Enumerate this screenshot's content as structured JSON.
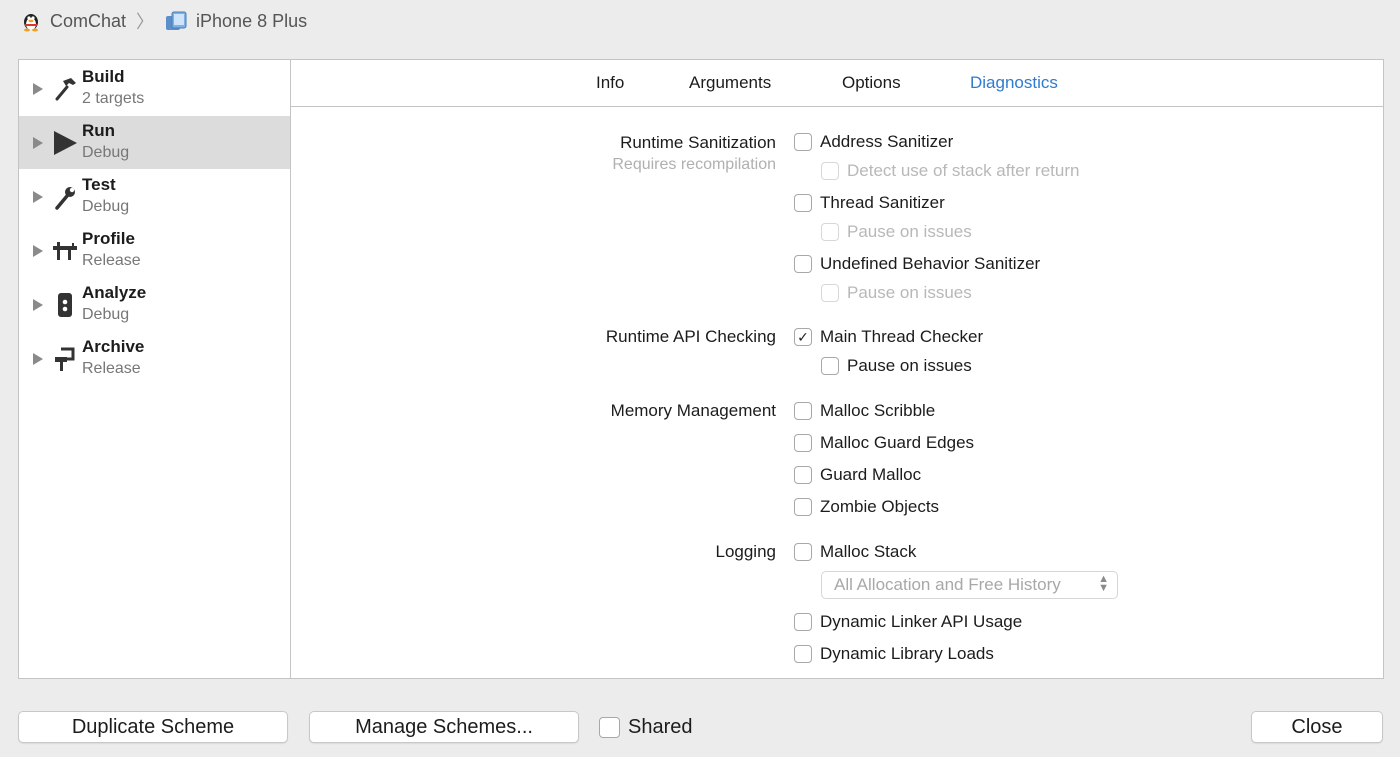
{
  "breadcrumb": {
    "scheme": "ComChat",
    "separator": "〉",
    "destination": "iPhone 8 Plus"
  },
  "sidebar": {
    "actions": [
      {
        "name": "Build",
        "sub": "2 targets",
        "icon": "hammer-icon",
        "selected": false
      },
      {
        "name": "Run",
        "sub": "Debug",
        "icon": "play-icon",
        "selected": true
      },
      {
        "name": "Test",
        "sub": "Debug",
        "icon": "wrench-icon",
        "selected": false
      },
      {
        "name": "Profile",
        "sub": "Release",
        "icon": "caliper-icon",
        "selected": false
      },
      {
        "name": "Analyze",
        "sub": "Debug",
        "icon": "analyze-icon",
        "selected": false
      },
      {
        "name": "Archive",
        "sub": "Release",
        "icon": "archive-icon",
        "selected": false
      }
    ]
  },
  "tabs": [
    {
      "label": "Info",
      "active": false
    },
    {
      "label": "Arguments",
      "active": false
    },
    {
      "label": "Options",
      "active": false
    },
    {
      "label": "Diagnostics",
      "active": true
    }
  ],
  "diagnostics": {
    "runtime_sanitization": {
      "label": "Runtime Sanitization",
      "note": "Requires recompilation",
      "options": [
        {
          "label": "Address Sanitizer",
          "checked": false,
          "enabled": true
        },
        {
          "label": "Detect use of stack after return",
          "checked": false,
          "enabled": false
        },
        {
          "label": "Thread Sanitizer",
          "checked": false,
          "enabled": true
        },
        {
          "label": "Pause on issues",
          "checked": false,
          "enabled": false
        },
        {
          "label": "Undefined Behavior Sanitizer",
          "checked": false,
          "enabled": true
        },
        {
          "label": "Pause on issues",
          "checked": false,
          "enabled": false
        }
      ]
    },
    "runtime_api_checking": {
      "label": "Runtime API Checking",
      "options": [
        {
          "label": "Main Thread Checker",
          "checked": true,
          "enabled": true
        },
        {
          "label": "Pause on issues",
          "checked": false,
          "enabled": true
        }
      ]
    },
    "memory_management": {
      "label": "Memory Management",
      "options": [
        {
          "label": "Malloc Scribble",
          "checked": false,
          "enabled": true
        },
        {
          "label": "Malloc Guard Edges",
          "checked": false,
          "enabled": true
        },
        {
          "label": "Guard Malloc",
          "checked": false,
          "enabled": true
        },
        {
          "label": "Zombie Objects",
          "checked": false,
          "enabled": true
        }
      ]
    },
    "logging": {
      "label": "Logging",
      "options": [
        {
          "label": "Malloc Stack",
          "checked": false,
          "enabled": true
        },
        {
          "label": "Dynamic Linker API Usage",
          "checked": false,
          "enabled": true
        },
        {
          "label": "Dynamic Library Loads",
          "checked": false,
          "enabled": true
        }
      ],
      "malloc_stack_mode": "All Allocation and Free History"
    }
  },
  "footer": {
    "duplicate_label": "Duplicate Scheme",
    "manage_label": "Manage Schemes...",
    "shared_label": "Shared",
    "shared_checked": false,
    "close_label": "Close"
  },
  "colors": {
    "accent": "#2f7bd0",
    "selected_row": "#dcdcdc",
    "disabled_text": "#b8b8b8"
  }
}
